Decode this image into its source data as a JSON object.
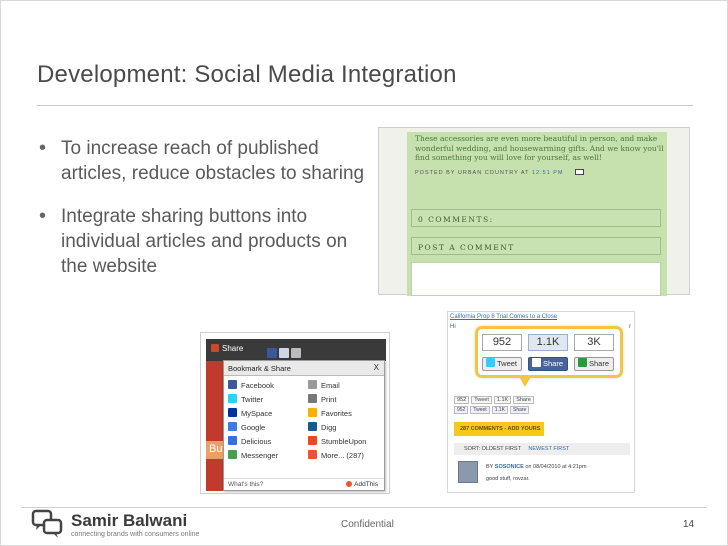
{
  "slide": {
    "title": "Development: Social Media Integration",
    "bullets": [
      "To increase reach of published articles, reduce obstacles to sharing",
      "Integrate sharing buttons into individual articles and products on the website"
    ]
  },
  "blog_screenshot": {
    "text": "These accessories are even more beautiful in person, and make wonderful wedding, and housewarming gifts. And we know you'll find something you will love for yourself, as well!",
    "posted_by": "POSTED BY URBAN COUNTRY AT",
    "posted_time": "12:51 PM",
    "comments_label": "0 COMMENTS:",
    "post_comment_label": "POST A COMMENT"
  },
  "bookmark_screenshot": {
    "share_label": "Share",
    "panel_title": "Bookmark & Share",
    "close_label": "X",
    "red_text": "Butt",
    "services": [
      {
        "name": "Facebook",
        "color": "#3b5998"
      },
      {
        "name": "Email",
        "color": "#9a9a9a"
      },
      {
        "name": "Twitter",
        "color": "#33ccff"
      },
      {
        "name": "Print",
        "color": "#777777"
      },
      {
        "name": "MySpace",
        "color": "#003399"
      },
      {
        "name": "Favorites",
        "color": "#f5b300"
      },
      {
        "name": "Google",
        "color": "#3c7be0"
      },
      {
        "name": "Digg",
        "color": "#1b5891"
      },
      {
        "name": "Delicious",
        "color": "#3274d0"
      },
      {
        "name": "StumbleUpon",
        "color": "#eb4924"
      },
      {
        "name": "Messenger",
        "color": "#44a04a"
      },
      {
        "name": "More... (287)",
        "color": "#e8562a"
      }
    ],
    "whats_this": "What's this?",
    "addthis": "AddThis"
  },
  "article_screenshot": {
    "header": "California Prop 8 Trial Comes to a Close",
    "hi": "Hi",
    "link_r": "r",
    "callout": {
      "count_tweet": "952",
      "count_fb": "1.1K",
      "count_share": "3K",
      "tweet_label": "Tweet",
      "fb_label": "Share",
      "share_label": "Share"
    },
    "small_counts": [
      "952",
      "1.1K",
      "952",
      "1.1K"
    ],
    "small_labels": [
      "Tweet",
      "Share",
      "Tweet",
      "Share"
    ],
    "comments_button": "287 COMMENTS - ADD YOURS",
    "sort_label": "SORT:",
    "sort_oldest": "OLDEST FIRST",
    "sort_newest": "NEWEST FIRST",
    "by": "BY",
    "user": "SOSONICE",
    "date": "on 08/04/2010 at 4:21pm",
    "comment": "good stuff, rovzar."
  },
  "footer": {
    "name": "Samir Balwani",
    "tagline": "connecting brands with consumers online",
    "confidential": "Confidential",
    "page": "14"
  }
}
